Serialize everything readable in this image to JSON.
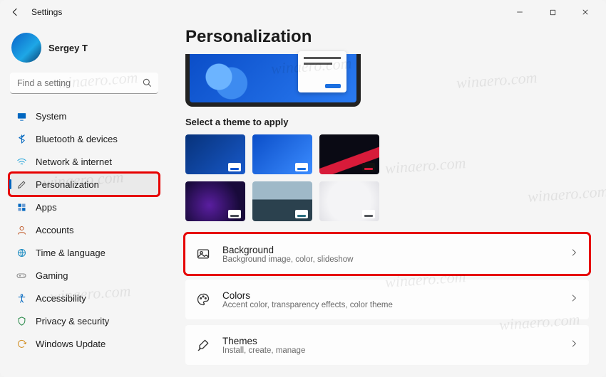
{
  "window": {
    "title": "Settings"
  },
  "user": {
    "name": "Sergey T"
  },
  "search": {
    "placeholder": "Find a setting"
  },
  "sidebar": {
    "items": [
      {
        "label": "System"
      },
      {
        "label": "Bluetooth & devices"
      },
      {
        "label": "Network & internet"
      },
      {
        "label": "Personalization"
      },
      {
        "label": "Apps"
      },
      {
        "label": "Accounts"
      },
      {
        "label": "Time & language"
      },
      {
        "label": "Gaming"
      },
      {
        "label": "Accessibility"
      },
      {
        "label": "Privacy & security"
      },
      {
        "label": "Windows Update"
      }
    ]
  },
  "page": {
    "title": "Personalization",
    "theme_section_label": "Select a theme to apply"
  },
  "options": [
    {
      "title": "Background",
      "subtitle": "Background image, color, slideshow"
    },
    {
      "title": "Colors",
      "subtitle": "Accent color, transparency effects, color theme"
    },
    {
      "title": "Themes",
      "subtitle": "Install, create, manage"
    }
  ],
  "watermark": "winaero.com"
}
